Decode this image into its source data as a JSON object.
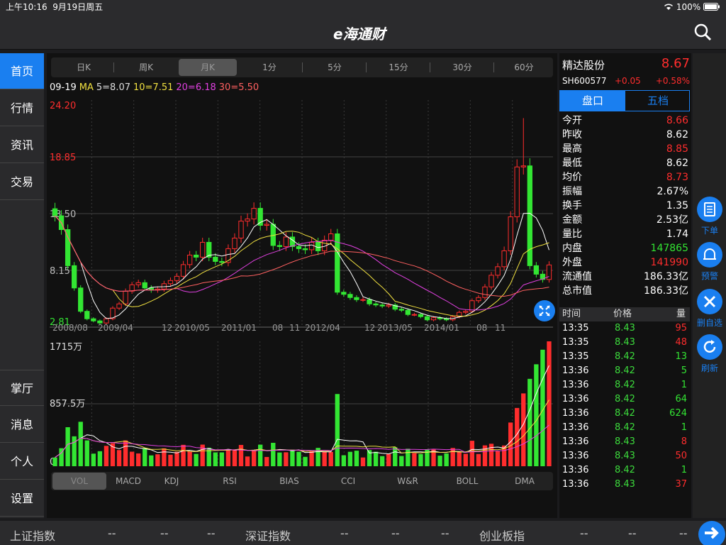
{
  "status": {
    "time": "上午10:16",
    "date": "9月19日周五",
    "battery": "100%"
  },
  "header": {
    "logo": "e海通财"
  },
  "nav": {
    "items": [
      "首页",
      "行情",
      "资讯",
      "交易"
    ],
    "bottom_items": [
      "掌厅",
      "消息",
      "个人",
      "设置"
    ]
  },
  "period_tabs": [
    "日K",
    "周K",
    "月K",
    "1分",
    "5分",
    "15分",
    "30分",
    "60分"
  ],
  "ma_legend": {
    "date": "09-19",
    "ma_label": "MA",
    "ma5": "5=8.07",
    "ma10": "10=7.51",
    "ma20": "20=6.18",
    "ma30": "30=5.50"
  },
  "indicator_tabs": [
    "VOL",
    "MACD",
    "KDJ",
    "RSI",
    "BIAS",
    "CCI",
    "W&R",
    "BOLL",
    "DMA"
  ],
  "colors": {
    "up": "#ff2d2d",
    "down": "#33e633",
    "ma5": "#ffffff",
    "ma10": "#f0e040",
    "ma20": "#e040e0",
    "ma30": "#ff6060",
    "accent": "#1a7ff0"
  },
  "chart_data": [
    {
      "type": "candlestick",
      "price_ticks": [
        "24.20",
        "18.85",
        "13.50",
        "8.15",
        "2.81"
      ],
      "ylim": [
        2.81,
        24.2
      ],
      "x_tick_labels": [
        "2008/08",
        "2009/04",
        "12",
        "2010/05",
        "2011/01",
        "08",
        "11",
        "2012/04",
        "12",
        "2013/05",
        "2014/01",
        "08",
        "11"
      ],
      "close": [
        13.3,
        12.0,
        8.6,
        6.5,
        4.3,
        3.6,
        3.4,
        3.2,
        3.6,
        4.6,
        5.0,
        6.2,
        6.8,
        7.0,
        6.5,
        6.3,
        6.4,
        6.9,
        7.2,
        7.6,
        8.7,
        9.6,
        9.4,
        10.8,
        9.4,
        9.0,
        8.9,
        10.2,
        11.2,
        12.8,
        13.0,
        14.0,
        12.4,
        12.5,
        10.5,
        10.4,
        11.3,
        10.4,
        10.2,
        10.1,
        10.8,
        10.0,
        11.0,
        11.6,
        6.1,
        5.9,
        5.6,
        5.4,
        5.4,
        5.0,
        4.9,
        4.8,
        4.9,
        4.5,
        4.4,
        4.0,
        4.0,
        3.8,
        3.5,
        3.7,
        3.6,
        3.5,
        3.8,
        4.2,
        4.3,
        5.3,
        5.6,
        6.6,
        7.7,
        8.5,
        10.0,
        13.2,
        17.9,
        18.0,
        8.6,
        7.8,
        7.3,
        8.67
      ],
      "volume_ticks": [
        "1715万",
        "857.5万",
        "0"
      ],
      "volume_max": 1715
    }
  ],
  "quote": {
    "name": "精达股份",
    "price": "8.67",
    "code": "SH600577",
    "change": "+0.05",
    "change_pct": "+0.58%",
    "tabs": [
      "盘口",
      "五档"
    ],
    "rows": [
      {
        "k": "今开",
        "v": "8.66",
        "c": "up"
      },
      {
        "k": "昨收",
        "v": "8.62",
        "c": "flat"
      },
      {
        "k": "最高",
        "v": "8.85",
        "c": "up"
      },
      {
        "k": "最低",
        "v": "8.62",
        "c": "flat"
      },
      {
        "k": "均价",
        "v": "8.73",
        "c": "up"
      },
      {
        "k": "振幅",
        "v": "2.67%",
        "c": "flat"
      },
      {
        "k": "换手",
        "v": "1.35",
        "c": "flat"
      },
      {
        "k": "金额",
        "v": "2.53亿",
        "c": "flat"
      },
      {
        "k": "量比",
        "v": "1.74",
        "c": "flat"
      },
      {
        "k": "内盘",
        "v": "147865",
        "c": "down"
      },
      {
        "k": "外盘",
        "v": "141990",
        "c": "up"
      },
      {
        "k": "流通值",
        "v": "186.33亿",
        "c": "flat"
      },
      {
        "k": "总市值",
        "v": "186.33亿",
        "c": "flat"
      }
    ],
    "trades_header": [
      "时间",
      "价格",
      "量"
    ],
    "trades": [
      {
        "t": "13:35",
        "p": "8.43",
        "q": "95",
        "c": "up"
      },
      {
        "t": "13:35",
        "p": "8.43",
        "q": "48",
        "c": "up"
      },
      {
        "t": "13:35",
        "p": "8.42",
        "q": "13",
        "c": "down"
      },
      {
        "t": "13:36",
        "p": "8.42",
        "q": "5",
        "c": "down"
      },
      {
        "t": "13:36",
        "p": "8.42",
        "q": "1",
        "c": "down"
      },
      {
        "t": "13:36",
        "p": "8.42",
        "q": "64",
        "c": "down"
      },
      {
        "t": "13:36",
        "p": "8.42",
        "q": "624",
        "c": "down"
      },
      {
        "t": "13:36",
        "p": "8.42",
        "q": "1",
        "c": "down"
      },
      {
        "t": "13:36",
        "p": "8.43",
        "q": "8",
        "c": "up"
      },
      {
        "t": "13:36",
        "p": "8.43",
        "q": "50",
        "c": "up"
      },
      {
        "t": "13:36",
        "p": "8.42",
        "q": "1",
        "c": "down"
      },
      {
        "t": "13:36",
        "p": "8.43",
        "q": "37",
        "c": "up"
      }
    ]
  },
  "side_actions": [
    "下单",
    "预警",
    "删自选",
    "刷新"
  ],
  "ticker": {
    "idx1": "上证指数",
    "idx2": "深证指数",
    "idx3": "创业板指",
    "placeholder": "--"
  }
}
